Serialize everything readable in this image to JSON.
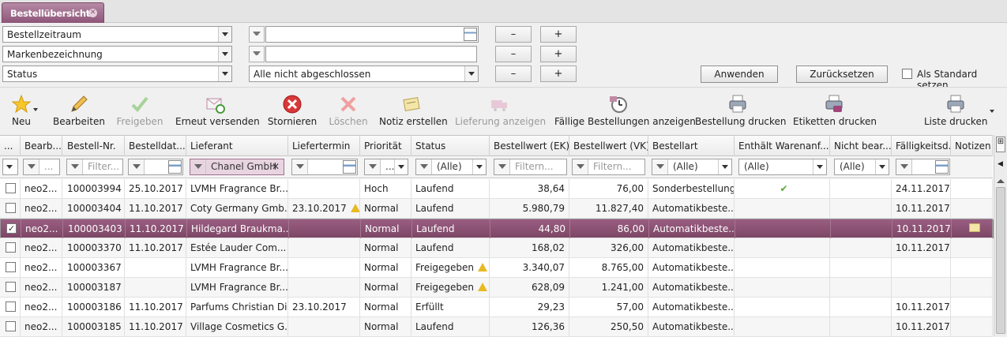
{
  "tab": {
    "title": "Bestellübersicht"
  },
  "filters": [
    {
      "field": "Bestellzeitraum",
      "value": ""
    },
    {
      "field": "Markenbezeichnung",
      "value": ""
    },
    {
      "field": "Status",
      "value": "Alle nicht abgeschlossen"
    }
  ],
  "filter_buttons": {
    "minus": "–",
    "plus": "+",
    "apply": "Anwenden",
    "reset": "Zurücksetzen",
    "default_label": "Als Standard setzen"
  },
  "toolbar": [
    {
      "label": "Neu",
      "icon": "star-new-icon",
      "enabled": true
    },
    {
      "label": "Bearbeiten",
      "icon": "pencil-icon",
      "enabled": true
    },
    {
      "label": "Freigeben",
      "icon": "checkmark-icon",
      "enabled": false
    },
    {
      "label": "Erneut versenden",
      "icon": "resend-mail-icon",
      "enabled": true
    },
    {
      "label": "Stornieren",
      "icon": "cancel-icon",
      "enabled": true
    },
    {
      "label": "Löschen",
      "icon": "delete-icon",
      "enabled": false
    },
    {
      "label": "Notiz erstellen",
      "icon": "note-icon",
      "enabled": true
    },
    {
      "label": "Lieferung anzeigen",
      "icon": "truck-icon",
      "enabled": false
    },
    {
      "label": "Fällige Bestellungen anzeigen",
      "icon": "due-orders-icon",
      "enabled": true
    },
    {
      "label": "Bestellung drucken",
      "icon": "print-order-icon",
      "enabled": true
    },
    {
      "label": "Etiketten drucken",
      "icon": "print-labels-icon",
      "enabled": true
    },
    {
      "label": "Liste drucken",
      "icon": "print-list-icon",
      "enabled": true
    }
  ],
  "columns": [
    "...",
    "Bearb...",
    "Bestell-Nr.",
    "Bestelldat...",
    "Lieferant",
    "Liefertermin",
    "Priorität",
    "Status",
    "Bestellwert (EK)",
    "Bestellwert (VK)",
    "Bestellart",
    "Enthält Warenanf...",
    "Nicht bear...",
    "Fälligkeitsd...",
    "Notizen"
  ],
  "column_filters": {
    "bestellnr": "Filter...",
    "lieferant": "Chanel GmbH",
    "status": "(Alle)",
    "ek": "Filtern...",
    "vk": "Filtern...",
    "bestellart": "(Alle)",
    "warenanf": "(Alle)",
    "nichtbear": "(Alle)",
    "bearb": "..."
  },
  "rows": [
    {
      "checked": false,
      "bearb": "neo2...",
      "nr": "100003994",
      "datum": "25.10.2017",
      "lieferant": "LVMH Fragrance Br...",
      "liefertermin": "",
      "prio": "Hoch",
      "status": "Laufend",
      "ek": "38,64",
      "vk": "76,00",
      "art": "Sonderbestellung",
      "waren": true,
      "faellig": "24.11.2017",
      "notiz": false,
      "warn_lt": false,
      "warn_st": false
    },
    {
      "checked": false,
      "bearb": "neo2...",
      "nr": "100003404",
      "datum": "11.10.2017",
      "lieferant": "Coty Germany Gmb...",
      "liefertermin": "23.10.2017",
      "prio": "Normal",
      "status": "Laufend",
      "ek": "5.980,79",
      "vk": "11.827,40",
      "art": "Automatikbeste...",
      "waren": false,
      "faellig": "10.11.2017",
      "notiz": false,
      "warn_lt": true,
      "warn_st": false
    },
    {
      "checked": true,
      "bearb": "neo2...",
      "nr": "100003403",
      "datum": "11.10.2017",
      "lieferant": "Hildegard Braukma...",
      "liefertermin": "",
      "prio": "Normal",
      "status": "Laufend",
      "ek": "44,80",
      "vk": "86,00",
      "art": "Automatikbeste...",
      "waren": false,
      "faellig": "10.11.2017",
      "notiz": true,
      "warn_lt": false,
      "warn_st": false
    },
    {
      "checked": false,
      "bearb": "neo2...",
      "nr": "100003370",
      "datum": "11.10.2017",
      "lieferant": "Estée Lauder Com...",
      "liefertermin": "",
      "prio": "Normal",
      "status": "Laufend",
      "ek": "168,02",
      "vk": "326,00",
      "art": "Automatikbeste...",
      "waren": false,
      "faellig": "10.11.2017",
      "notiz": false,
      "warn_lt": false,
      "warn_st": false
    },
    {
      "checked": false,
      "bearb": "neo2...",
      "nr": "100003367",
      "datum": "",
      "lieferant": "LVMH Fragrance Br...",
      "liefertermin": "",
      "prio": "Normal",
      "status": "Freigegeben",
      "ek": "3.340,07",
      "vk": "8.765,00",
      "art": "Automatikbeste...",
      "waren": false,
      "faellig": "",
      "notiz": false,
      "warn_lt": false,
      "warn_st": true
    },
    {
      "checked": false,
      "bearb": "neo2...",
      "nr": "100003187",
      "datum": "",
      "lieferant": "LVMH Fragrance Br...",
      "liefertermin": "",
      "prio": "Normal",
      "status": "Freigegeben",
      "ek": "628,09",
      "vk": "1.241,00",
      "art": "Automatikbeste...",
      "waren": false,
      "faellig": "",
      "notiz": false,
      "warn_lt": false,
      "warn_st": true
    },
    {
      "checked": false,
      "bearb": "neo2...",
      "nr": "100003186",
      "datum": "11.10.2017",
      "lieferant": "Parfums Christian Di...",
      "liefertermin": "23.10.2017",
      "prio": "Normal",
      "status": "Erfüllt",
      "ek": "29,23",
      "vk": "57,00",
      "art": "Automatikbeste...",
      "waren": false,
      "faellig": "10.11.2017",
      "notiz": false,
      "warn_lt": false,
      "warn_st": false
    },
    {
      "checked": false,
      "bearb": "neo2...",
      "nr": "100003185",
      "datum": "11.10.2017",
      "lieferant": "Village Cosmetics G...",
      "liefertermin": "",
      "prio": "Normal",
      "status": "Laufend",
      "ek": "126,36",
      "vk": "250,50",
      "art": "Automatikbeste...",
      "waren": false,
      "faellig": "10.11.2017",
      "notiz": false,
      "warn_lt": false,
      "warn_st": false
    }
  ],
  "colors": {
    "accent": "#8e5578",
    "selected_row": "#8a5273",
    "warning": "#e8b923",
    "check": "#5aa83c"
  }
}
